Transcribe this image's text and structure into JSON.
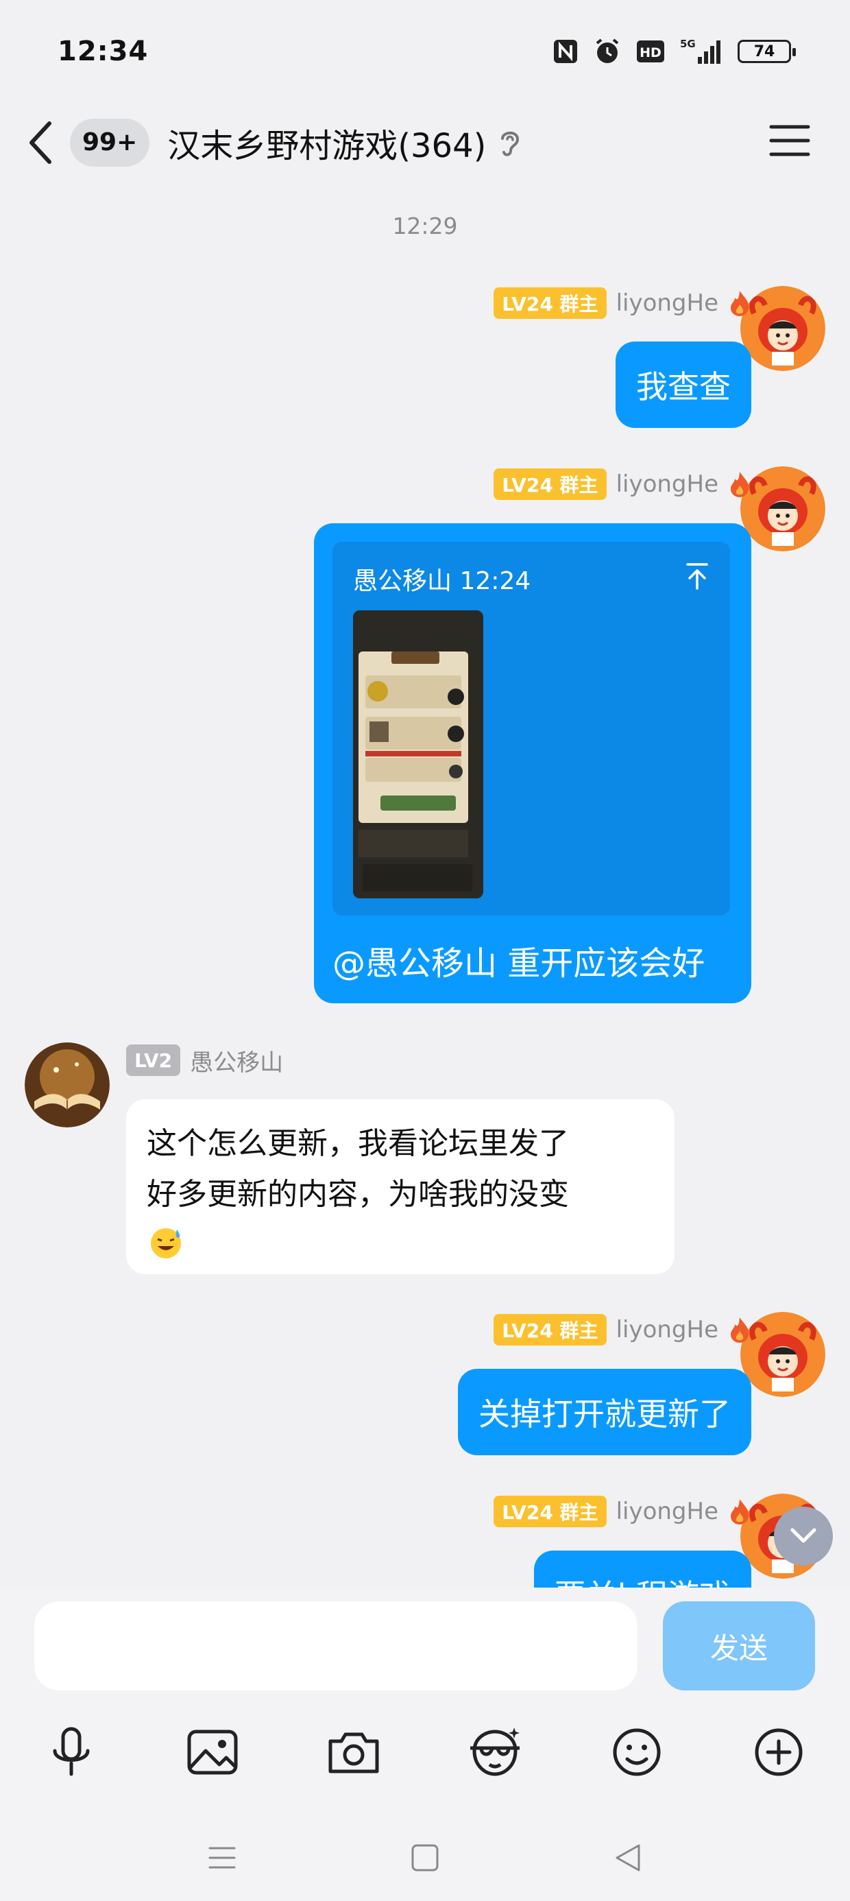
{
  "status_bar": {
    "time": "12:34",
    "network": "5G",
    "hd_label": "HD",
    "battery": "74",
    "icons": [
      "nfc-icon",
      "alarm-icon",
      "hd-icon",
      "signal-5g-icon",
      "battery-icon"
    ]
  },
  "header": {
    "back_icon": "chevron-left-icon",
    "unread_count": "99+",
    "title": "汉末乡野村游戏(364)",
    "ear_icon": "ear-icon",
    "menu_icon": "hamburger-menu-icon"
  },
  "chat": {
    "timestamp": "12:29",
    "messages": [
      {
        "side": "right",
        "level": "LV24 群主",
        "sender": "liyongHe",
        "text": "我查查"
      },
      {
        "side": "right",
        "level": "LV24 群主",
        "sender": "liyongHe",
        "quote_header": "愚公移山 12:24",
        "text": "@愚公移山 重开应该会好"
      },
      {
        "side": "left",
        "level": "LV2",
        "sender": "愚公移山",
        "text_line1": "这个怎么更新，我看论坛里发了",
        "text_line2": "好多更新的内容，为啥我的没变",
        "emoji": "grinning-sweat-emoji"
      },
      {
        "side": "right",
        "level": "LV24 群主",
        "sender": "liyongHe",
        "text": "关掉打开就更新了"
      },
      {
        "side": "right",
        "level": "LV24 群主",
        "sender": "liyongHe",
        "text": "要关l 程游戏"
      }
    ]
  },
  "composer": {
    "input_value": "",
    "send_label": "发送",
    "tools": [
      "microphone-icon",
      "image-icon",
      "camera-icon",
      "face-filter-icon",
      "emoji-icon",
      "plus-icon"
    ]
  },
  "system_nav": [
    "recent-apps-icon",
    "home-icon",
    "back-triangle-icon"
  ],
  "colors": {
    "bubble_blue": "#0a9aff",
    "badge_gold": "#fbc02d",
    "send_disabled": "#7fc6fa",
    "background": "#f1f1f3"
  }
}
